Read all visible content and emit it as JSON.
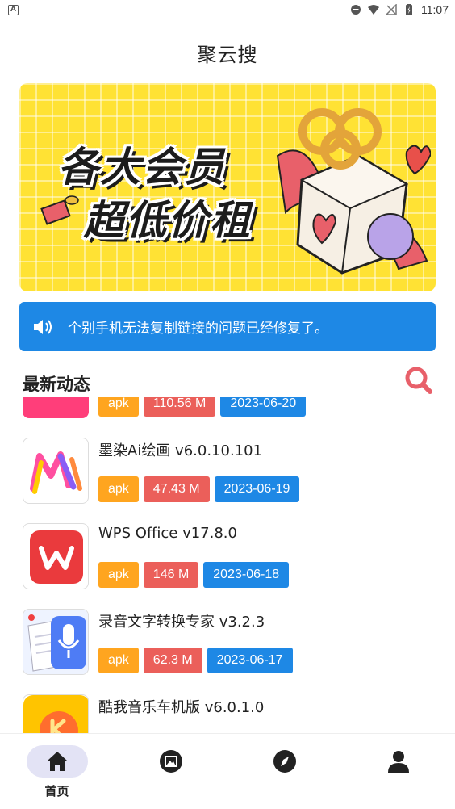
{
  "status_bar": {
    "time": "11:07"
  },
  "header": {
    "title": "聚云搜"
  },
  "banner": {
    "line1": "各大会员",
    "line2": "超低价租"
  },
  "notice": {
    "text": "个别手机无法复制链接的问题已经修复了。"
  },
  "section": {
    "title": "最新动态"
  },
  "apps": [
    {
      "name": "",
      "type": "apk",
      "size": "110.56 M",
      "date": "2023-06-20",
      "icon": "pink-app-icon"
    },
    {
      "name": "墨染Ai绘画 v6.0.10.101",
      "type": "apk",
      "size": "47.43 M",
      "date": "2023-06-19",
      "icon": "moran-ai-icon"
    },
    {
      "name": "WPS Office v17.8.0",
      "type": "apk",
      "size": "146 M",
      "date": "2023-06-18",
      "icon": "wps-icon"
    },
    {
      "name": "录音文字转换专家 v3.2.3",
      "type": "apk",
      "size": "62.3 M",
      "date": "2023-06-17",
      "icon": "recorder-icon"
    },
    {
      "name": "酷我音乐车机版 v6.0.1.0",
      "type": "",
      "size": "",
      "date": "",
      "icon": "kuwo-icon"
    }
  ],
  "nav": {
    "home_label": "首页"
  },
  "colors": {
    "accent_blue": "#1e88e5",
    "tag_orange": "#ffa51f",
    "tag_red": "#eb5f5a",
    "banner_yellow": "#ffe234"
  }
}
